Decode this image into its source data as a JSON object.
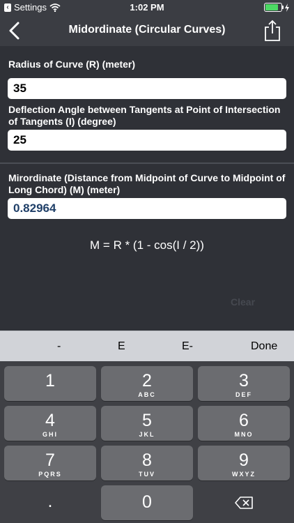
{
  "status_bar": {
    "back_app": "Settings",
    "time": "1:02 PM"
  },
  "nav": {
    "title": "Midordinate (Circular Curves)"
  },
  "inputs": [
    {
      "label": "Radius of Curve (R) (meter)",
      "value": "35"
    },
    {
      "label": "Deflection Angle between Tangents at Point of Intersection of Tangents (I) (degree)",
      "value": "25"
    }
  ],
  "result": {
    "label": "Mirordinate (Distance from Midpoint of Curve to Midpoint of Long Chord) (M) (meter)",
    "value": "0.82964"
  },
  "formula": "M = R * (1 - cos(I / 2))",
  "clear_label": "Clear",
  "accessory": {
    "minus": "-",
    "e": "E",
    "e_minus": "E-",
    "done": "Done"
  },
  "keys": [
    {
      "num": "1",
      "sub": ""
    },
    {
      "num": "2",
      "sub": "ABC"
    },
    {
      "num": "3",
      "sub": "DEF"
    },
    {
      "num": "4",
      "sub": "GHI"
    },
    {
      "num": "5",
      "sub": "JKL"
    },
    {
      "num": "6",
      "sub": "MNO"
    },
    {
      "num": "7",
      "sub": "PQRS"
    },
    {
      "num": "8",
      "sub": "TUV"
    },
    {
      "num": "9",
      "sub": "WXYZ"
    },
    {
      "num": ".",
      "sub": ""
    },
    {
      "num": "0",
      "sub": ""
    }
  ],
  "colors": {
    "background": "#2f3137",
    "navbar": "#3b3d43",
    "result_text": "#1f3f68",
    "battery": "#4cd964"
  },
  "icons": [
    "back-chevron-icon",
    "share-icon",
    "wifi-icon",
    "battery-icon",
    "charging-bolt-icon",
    "backspace-icon"
  ]
}
